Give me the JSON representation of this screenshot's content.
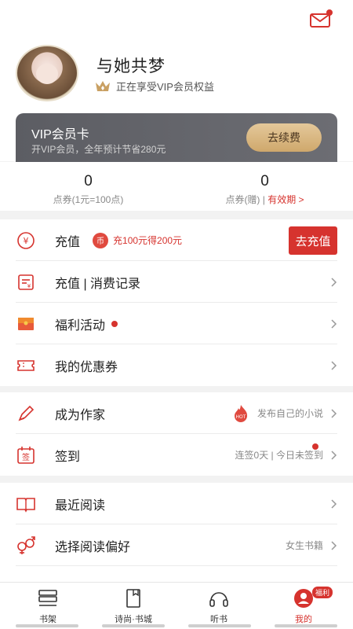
{
  "header": {
    "username": "与她共梦",
    "vip_status": "正在享受VIP会员权益"
  },
  "vip_card": {
    "title": "VIP会员卡",
    "subtitle": "开VIP会员，全年预计节省280元",
    "renew_label": "去续费"
  },
  "stats": [
    {
      "value": "0",
      "label": "点券(1元=100点)"
    },
    {
      "value": "0",
      "label": "点券(赠) | ",
      "link": "有效期 >"
    }
  ],
  "menu": {
    "recharge": {
      "label": "充值",
      "promo_icon": "币",
      "promo": "充100元得200元",
      "button": "去充值"
    },
    "records": {
      "label": "充值 | 消费记录"
    },
    "welfare": {
      "label": "福利活动"
    },
    "coupons": {
      "label": "我的优惠券"
    },
    "writer": {
      "label": "成为作家",
      "hint": "发布自己的小说"
    },
    "signin": {
      "label": "签到",
      "hint": "连签0天 | 今日未签到",
      "icon_text": "签"
    },
    "recent": {
      "label": "最近阅读"
    },
    "preference": {
      "label": "选择阅读偏好",
      "hint": "女生书籍"
    }
  },
  "tabbar": {
    "items": [
      {
        "label": "书架"
      },
      {
        "label": "诗尚·书城"
      },
      {
        "label": "听书"
      },
      {
        "label": "我的"
      }
    ],
    "badge": "福利"
  },
  "colors": {
    "accent": "#d6332e",
    "vip_gold": "#cfa86c",
    "vip_card": "#5c5d63"
  },
  "icons": [
    "mail-icon",
    "crown-icon",
    "yen-icon",
    "receipt-icon",
    "gift-icon",
    "coupon-icon",
    "pen-icon",
    "fire-icon",
    "calendar-icon",
    "book-icon",
    "gender-icon",
    "chevron-right-icon",
    "bookshelf-icon",
    "bookstore-icon",
    "headphones-icon",
    "profile-icon"
  ]
}
